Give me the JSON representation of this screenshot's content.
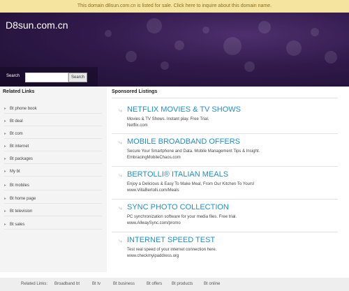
{
  "banner": {
    "text": "This domain d8sun.com.cn is listed for sale. Click here to inquire about this domain name."
  },
  "header": {
    "site_title": "D8sun.com.cn",
    "search": {
      "label": "Search",
      "placeholder": "",
      "button_label": "Search"
    }
  },
  "related_links": {
    "title": "Related Links",
    "items": [
      {
        "label": "Bt phone book"
      },
      {
        "label": "Bt deal"
      },
      {
        "label": "Bt com"
      },
      {
        "label": "Bt internet"
      },
      {
        "label": "Bt packages"
      },
      {
        "label": "My bt"
      },
      {
        "label": "Bt mobiles"
      },
      {
        "label": "Bt home page"
      },
      {
        "label": "Bt television"
      },
      {
        "label": "Bt sales"
      }
    ]
  },
  "sponsored": {
    "title": "Sponsored Listings",
    "listings": [
      {
        "title": "Netflix Movies & TV Shows",
        "desc": "Movies & TV Shows. Instant play. Free Trial.",
        "url": "Netflix.com"
      },
      {
        "title": "Mobile Broadband Offers",
        "desc": "Secure Your Smartphone and Data. Mobile Management Tips & Insight.",
        "url": "EmbracingMobileChaos.com"
      },
      {
        "title": "Bertolli® Italian Meals",
        "desc": "Enjoy a Delicious & Easy To Make Meal, From Our Kitchen To Yours!",
        "url": "www.VillaBertolli.com/Meals"
      },
      {
        "title": "Sync Photo Collection",
        "desc": "PC synchronization software for your media files. Free trial.",
        "url": "www.AllwaySync.com/promo"
      },
      {
        "title": "Internet Speed Test",
        "desc": "Test real speed of your internet connection here.",
        "url": "www.checkmyipaddress.org"
      }
    ]
  },
  "footer": {
    "label": "Related Links:",
    "links": [
      {
        "label": "Broadband bt"
      },
      {
        "label": "Bt tv"
      },
      {
        "label": "Bt business"
      },
      {
        "label": "Bt offers"
      },
      {
        "label": "Bt products"
      },
      {
        "label": "Bt online"
      }
    ]
  },
  "colors": {
    "banner_bg": "#f4e4a0",
    "header_bg": "#311a4b",
    "link_blue": "#1f8fc9",
    "sidebar_bg": "#f4f4f4"
  },
  "icons": {
    "related_arrow": "arrow-right-icon",
    "listing_link": "link-icon"
  }
}
